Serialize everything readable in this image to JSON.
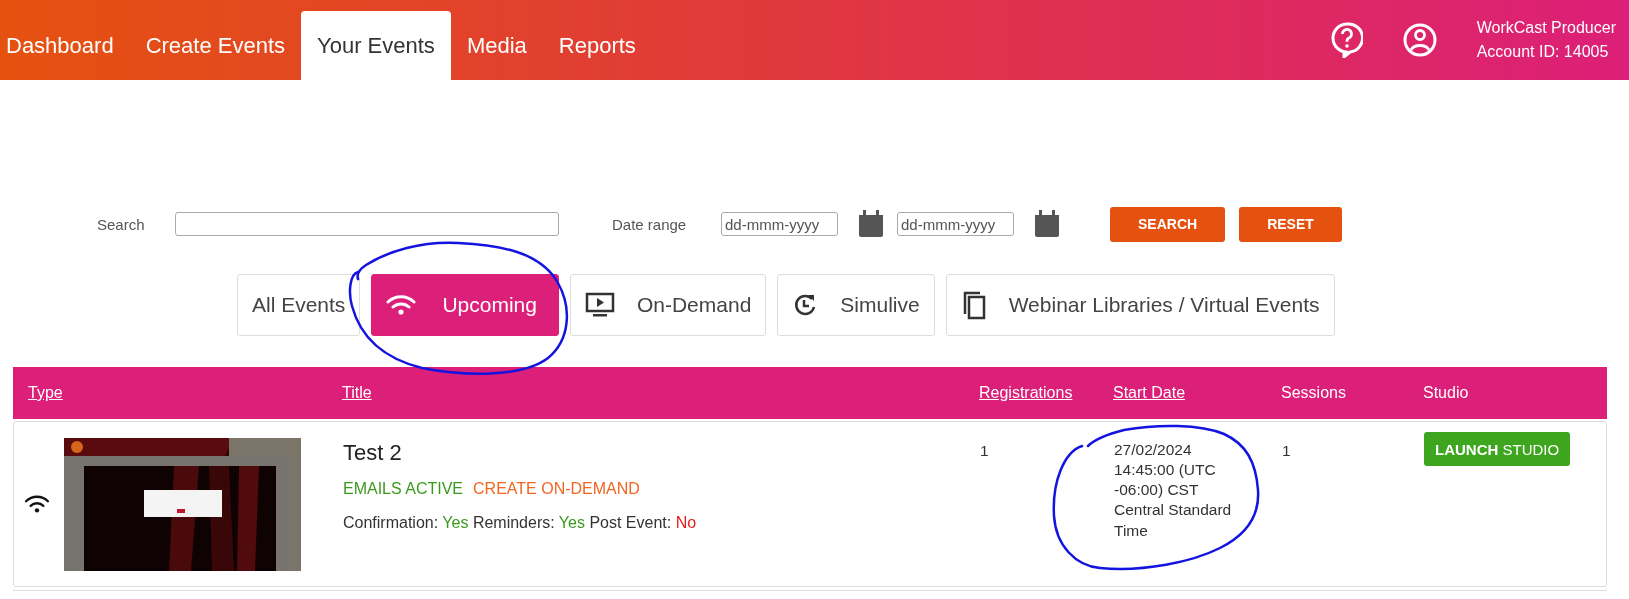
{
  "nav": {
    "tabs": [
      {
        "label": "Dashboard",
        "selected": false
      },
      {
        "label": "Create Events",
        "selected": false
      },
      {
        "label": "Your Events",
        "selected": true
      },
      {
        "label": "Media",
        "selected": false
      },
      {
        "label": "Reports",
        "selected": false
      }
    ]
  },
  "account": {
    "name": "WorkCast Producer",
    "id": "Account ID: 14005"
  },
  "filters": {
    "search_label": "Search",
    "date_label": "Date range",
    "date_from": {
      "placeholder": "dd-mmm-yyyy"
    },
    "date_to": {
      "placeholder": "dd-mmm-yyyy"
    },
    "buttons": [
      "SEARCH",
      "RESET"
    ]
  },
  "event_tabs": [
    {
      "label": "All Events",
      "kind": "all",
      "selected": false
    },
    {
      "label": "Upcoming",
      "kind": "live",
      "selected": true
    },
    {
      "label": "On-Demand",
      "kind": "on-demand",
      "selected": false
    },
    {
      "label": "Simulive",
      "kind": "simulive",
      "selected": false
    },
    {
      "label": "Webinar Libraries / Virtual Events",
      "kind": "library",
      "selected": false
    }
  ],
  "table": {
    "columns": [
      {
        "label": "Type",
        "link": true
      },
      {
        "label": "Title",
        "link": true
      },
      {
        "label": "Registrations",
        "link": true
      },
      {
        "label": "Start Date",
        "link": true
      },
      {
        "label": "Sessions",
        "link": false
      },
      {
        "label": "Studio",
        "link": false
      }
    ],
    "rows": [
      {
        "kind": "live",
        "thumbnail": {
          "kind": "picture"
        },
        "title": "Test 2",
        "statuses": [
          {
            "label": "EMAILS ACTIVE",
            "color": "#3a9a1e"
          },
          {
            "label": "CREATE ON-DEMAND",
            "color": "#f26522"
          }
        ],
        "flags": [
          {
            "label": "Confirmation:",
            "value": "Yes",
            "on": true
          },
          {
            "label": "Reminders:",
            "value": "Yes",
            "on": true
          },
          {
            "label": "Post Event:",
            "value": "No",
            "on": false
          }
        ],
        "registrations": "1",
        "start_date": "27/02/2024 14:45:00 (UTC -06:00) CST Central Standard Time",
        "sessions": "1",
        "studio_button": "**LAUNCH** STUDIO"
      }
    ]
  }
}
